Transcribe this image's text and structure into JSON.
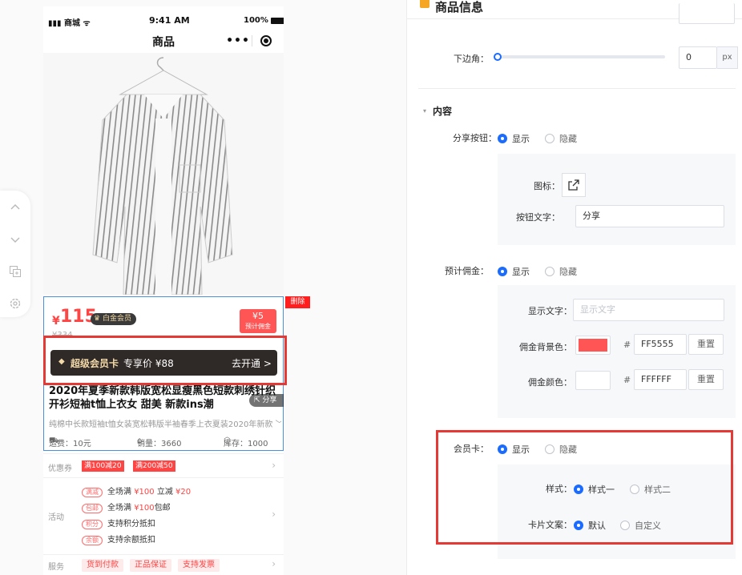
{
  "phone": {
    "status": {
      "carrier": "商城",
      "time": "9:41 AM",
      "battery": "100%"
    },
    "nav_title": "商品",
    "capsule_more": "•••"
  },
  "goods": {
    "currency": "¥",
    "price": "115",
    "vip_tag": "白金会员",
    "original_price": "¥334",
    "commission_value": "¥5",
    "commission_label": "预计佣金",
    "delete_label": "删除",
    "member_card": {
      "name": "超级会员卡",
      "exclusive_price": "专享价 ¥88",
      "cta": "去开通 >"
    },
    "title": "2020年夏季新款韩版宽松显瘦黑色短款刺绣针织开衫短袖t恤上衣女 甜美 新款ins潮",
    "share_label": "分享",
    "desc": "纯棉中长款短袖t恤女装宽松韩版半袖春季上衣夏装2020年新款",
    "stats": {
      "freight": "运费：10元",
      "sales": "销量：3660",
      "stock": "库存：1000"
    }
  },
  "coupon_row": {
    "label": "优惠券",
    "coupons": [
      "满100减20",
      "满200减50"
    ]
  },
  "activity_row": {
    "label": "活动",
    "items": [
      {
        "tag": "满减",
        "pre": "全场满",
        "v1": "¥100",
        "mid": "立减",
        "v2": "¥20"
      },
      {
        "tag": "包邮",
        "pre": "全场满",
        "v1": "¥100",
        "mid": "包邮",
        "v2": ""
      },
      {
        "tag": "积分",
        "pre": "支持积分抵扣",
        "v1": "",
        "mid": "",
        "v2": ""
      },
      {
        "tag": "余额",
        "pre": "支持余额抵扣",
        "v1": "",
        "mid": "",
        "v2": ""
      }
    ]
  },
  "service_row": {
    "label": "服务",
    "items": [
      "货到付款",
      "正品保证",
      "支持发票"
    ]
  },
  "panel": {
    "header": "商品信息",
    "bottom_radius": {
      "label": "下边角：",
      "value": "0",
      "unit": "px",
      "slider_fraction": 0
    },
    "content_section": "内容",
    "share_button": {
      "label": "分享按钮：",
      "on": "显示",
      "off": "隐藏",
      "icon_label": "图标：",
      "text_label": "按钮文字：",
      "text_value": "分享"
    },
    "commission": {
      "label": "预计佣金：",
      "on": "显示",
      "off": "隐藏",
      "display_text_label": "显示文字：",
      "display_text_placeholder": "显示文字",
      "bg_label": "佣金背景色：",
      "bg_color": "#FF5555",
      "bg_hex": "FF5555",
      "bg_reset": "重置",
      "fg_label": "佣金颜色：",
      "fg_color": "#FFFFFF",
      "fg_hex": "FFFFFF",
      "fg_reset": "重置",
      "hash": "#"
    },
    "member_card": {
      "label": "会员卡：",
      "on": "显示",
      "off": "隐藏",
      "style_label": "样式：",
      "style1": "样式一",
      "style2": "样式二",
      "copy_label": "卡片文案：",
      "copy_default": "默认",
      "copy_custom": "自定义"
    }
  },
  "colors": {
    "accent": "#1A6BFF",
    "price": "#FF4444",
    "highlight": "#E53935",
    "header_mark": "#F5A623"
  }
}
